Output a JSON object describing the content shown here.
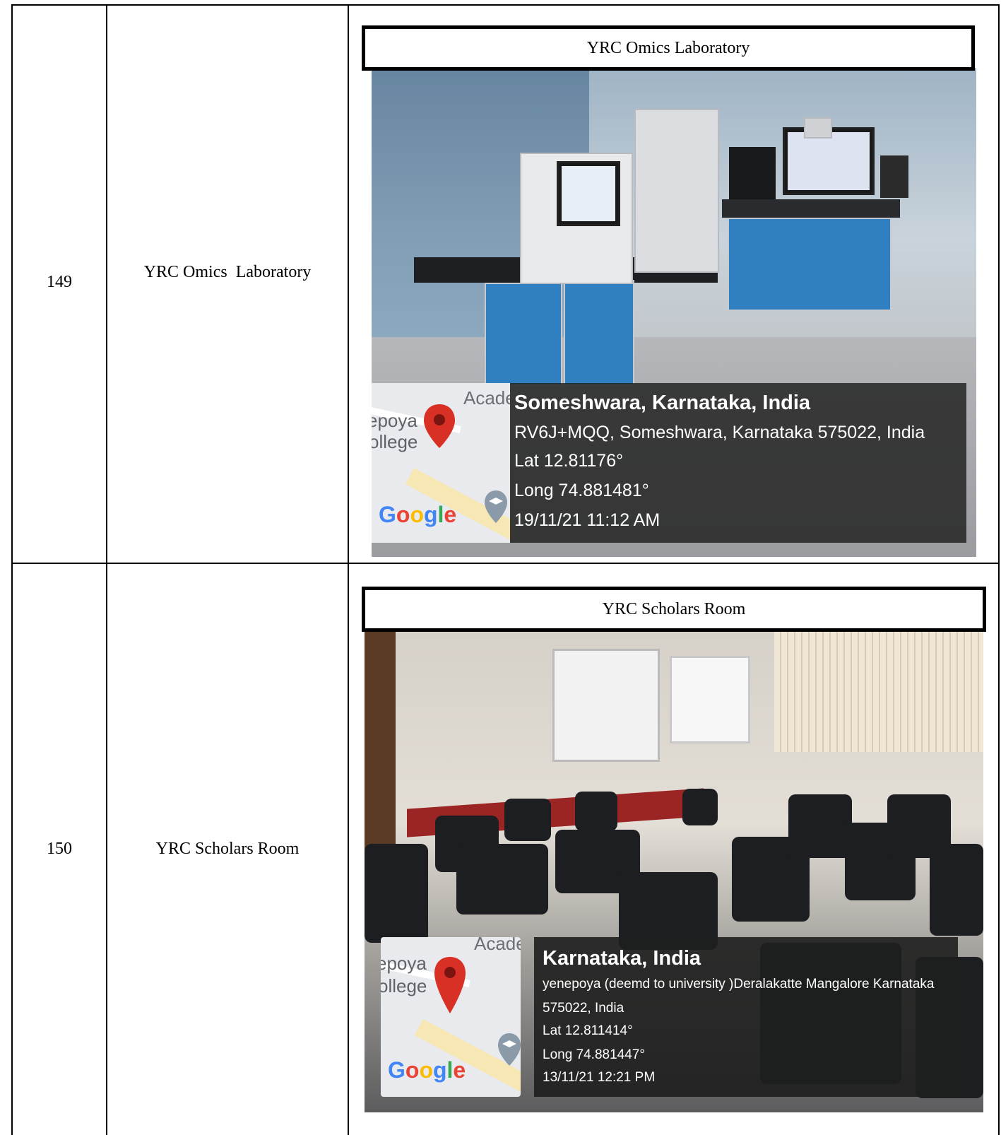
{
  "rows": [
    {
      "number": "149",
      "name": "YRC Omics  Laboratory",
      "photo": {
        "caption": "YRC Omics Laboratory",
        "map_labels": {
          "top": "Acade",
          "college_1": "epoya",
          "college_2": "ollege",
          "logo": "Google"
        },
        "geo": {
          "place": "Someshwara, Karnataka, India",
          "address": "RV6J+MQQ, Someshwara, Karnataka 575022, India",
          "lat": "Lat 12.81176°",
          "long": "Long 74.881481°",
          "datetime": "19/11/21 11:12 AM"
        }
      }
    },
    {
      "number": "150",
      "name": "YRC Scholars Room",
      "photo": {
        "caption": "YRC Scholars Room",
        "map_labels": {
          "top": "Acade",
          "college_1": "epoya",
          "college_2": "ollege",
          "logo": "Google"
        },
        "geo": {
          "place": "Karnataka, India",
          "address_line1": "yenepoya (deemd to university )Deralakatte Mangalore Karnataka",
          "address_line2": "575022, India",
          "lat": "Lat 12.811414°",
          "long": "Long 74.881447°",
          "datetime": "13/11/21 12:21 PM"
        }
      }
    }
  ],
  "colors": {
    "pin": "#d93025",
    "panel": "#282828",
    "cabinet": "#2f7fc1"
  },
  "icons": [
    "map-pin-icon",
    "education-icon"
  ]
}
